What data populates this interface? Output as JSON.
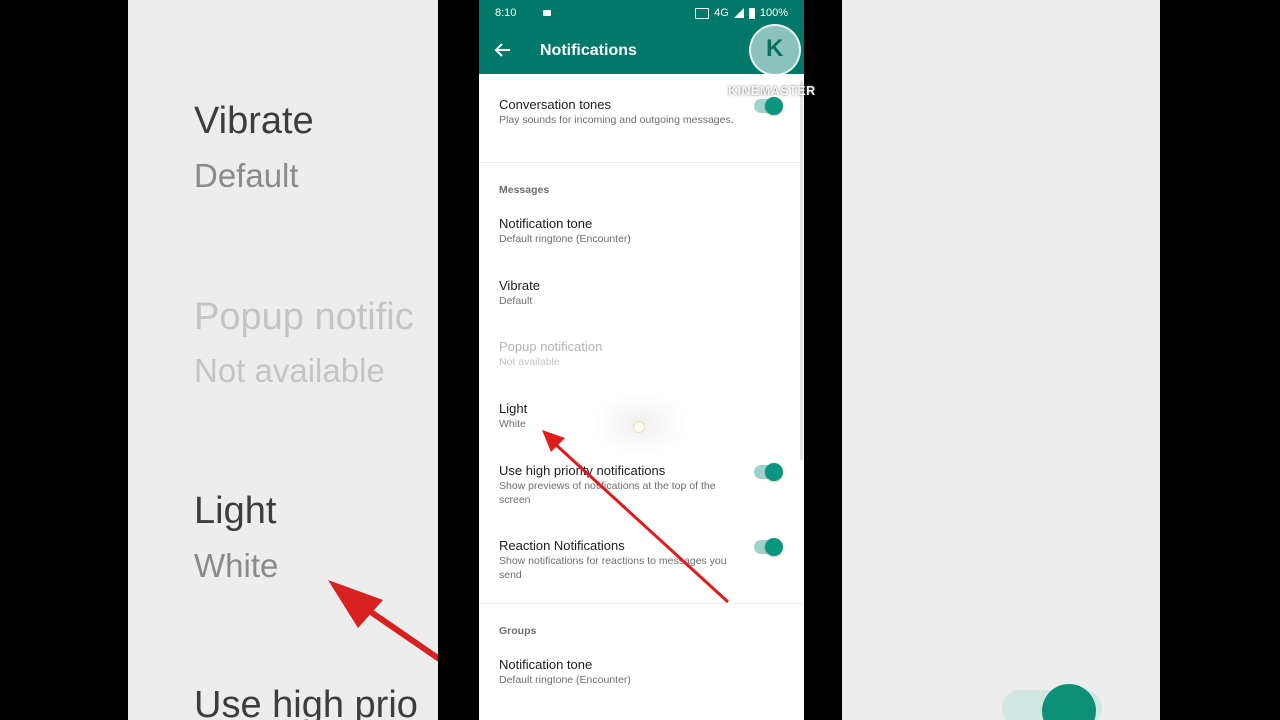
{
  "status_bar": {
    "time": "8:10",
    "network": "4G",
    "battery": "100%"
  },
  "app_bar": {
    "title": "Notifications",
    "back_icon": "arrow-left-icon"
  },
  "watermark": {
    "logo_letter": "K",
    "text": "KINEMASTER"
  },
  "background_mirror": {
    "vibrate": "Vibrate",
    "vibrate_sub": "Default",
    "popup": "Popup notific",
    "popup_sub": "Not available",
    "light": "Light",
    "light_sub": "White",
    "high_priority": "Use high prio"
  },
  "settings": {
    "conversation_tones": {
      "title": "Conversation tones",
      "subtitle": "Play sounds for incoming and outgoing messages.",
      "enabled": true
    },
    "messages_header": "Messages",
    "messages_tone": {
      "title": "Notification tone",
      "subtitle": "Default ringtone (Encounter)"
    },
    "vibrate": {
      "title": "Vibrate",
      "subtitle": "Default"
    },
    "popup": {
      "title": "Popup notification",
      "subtitle": "Not available"
    },
    "light": {
      "title": "Light",
      "subtitle": "White"
    },
    "high_priority": {
      "title": "Use high priority notifications",
      "subtitle": "Show previews of notifications at the top of the screen",
      "enabled": true
    },
    "reactions": {
      "title": "Reaction Notifications",
      "subtitle": "Show notifications for reactions to messages you send",
      "enabled": true
    },
    "groups_header": "Groups",
    "groups_tone": {
      "title": "Notification tone",
      "subtitle": "Default ringtone (Encounter)"
    }
  },
  "colors": {
    "appbar": "#00786a",
    "toggle_on": "#0b9680",
    "annotation_arrow": "#e01b1b"
  }
}
